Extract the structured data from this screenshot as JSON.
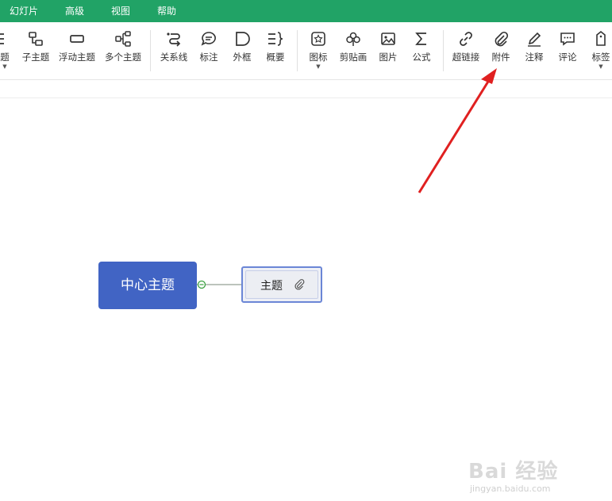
{
  "menubar": {
    "items": [
      "幻灯片",
      "高级",
      "视图",
      "帮助"
    ]
  },
  "toolbar": {
    "tools": [
      {
        "label": "题",
        "icon": "topic-icon"
      },
      {
        "label": "子主题",
        "icon": "subtopic-icon"
      },
      {
        "label": "浮动主题",
        "icon": "floating-topic-icon"
      },
      {
        "label": "多个主题",
        "icon": "multiple-topics-icon"
      },
      {
        "label": "关系线",
        "icon": "relationship-icon"
      },
      {
        "label": "标注",
        "icon": "callout-icon"
      },
      {
        "label": "外框",
        "icon": "boundary-icon"
      },
      {
        "label": "概要",
        "icon": "summary-icon"
      },
      {
        "label": "图标",
        "icon": "icon-marker-icon"
      },
      {
        "label": "剪贴画",
        "icon": "clipart-icon"
      },
      {
        "label": "图片",
        "icon": "image-icon"
      },
      {
        "label": "公式",
        "icon": "formula-icon"
      },
      {
        "label": "超链接",
        "icon": "hyperlink-icon"
      },
      {
        "label": "附件",
        "icon": "attachment-icon"
      },
      {
        "label": "注释",
        "icon": "note-icon"
      },
      {
        "label": "评论",
        "icon": "comment-icon"
      },
      {
        "label": "标签",
        "icon": "tag-icon"
      }
    ]
  },
  "mindmap": {
    "center_topic": "中心主题",
    "sub_topic": "主题",
    "accent_color": "#4164c4",
    "arrow_color": "#e02020"
  },
  "watermark": {
    "logo": "Bai 经验",
    "url": "jingyan.baidu.com"
  }
}
